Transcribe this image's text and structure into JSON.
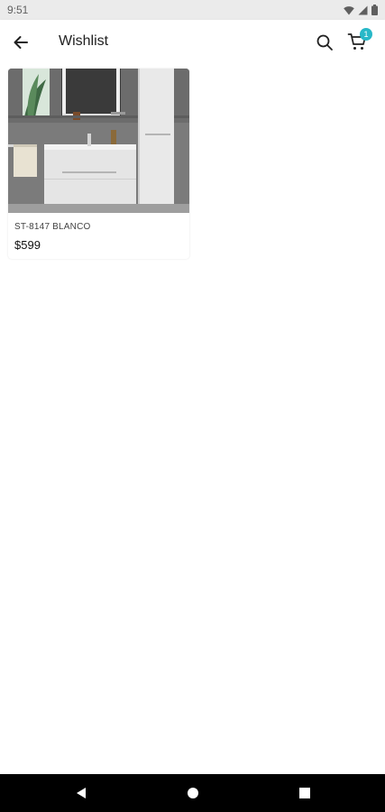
{
  "status_bar": {
    "time": "9:51",
    "icons": [
      "wifi-icon",
      "signal-icon",
      "battery-icon"
    ]
  },
  "app_bar": {
    "title": "Wishlist",
    "icons": [
      "back-arrow-icon",
      "search-icon",
      "cart-icon"
    ],
    "cart_badge_count": "1",
    "accent_color": "#27b8c8"
  },
  "wishlist": {
    "items": [
      {
        "name": "ST-8147 BLANCO",
        "price": "$599",
        "image": "bathroom-vanity-image"
      }
    ]
  },
  "nav_bar": {
    "icons": [
      "back-triangle-icon",
      "home-circle-icon",
      "recents-square-icon"
    ]
  }
}
